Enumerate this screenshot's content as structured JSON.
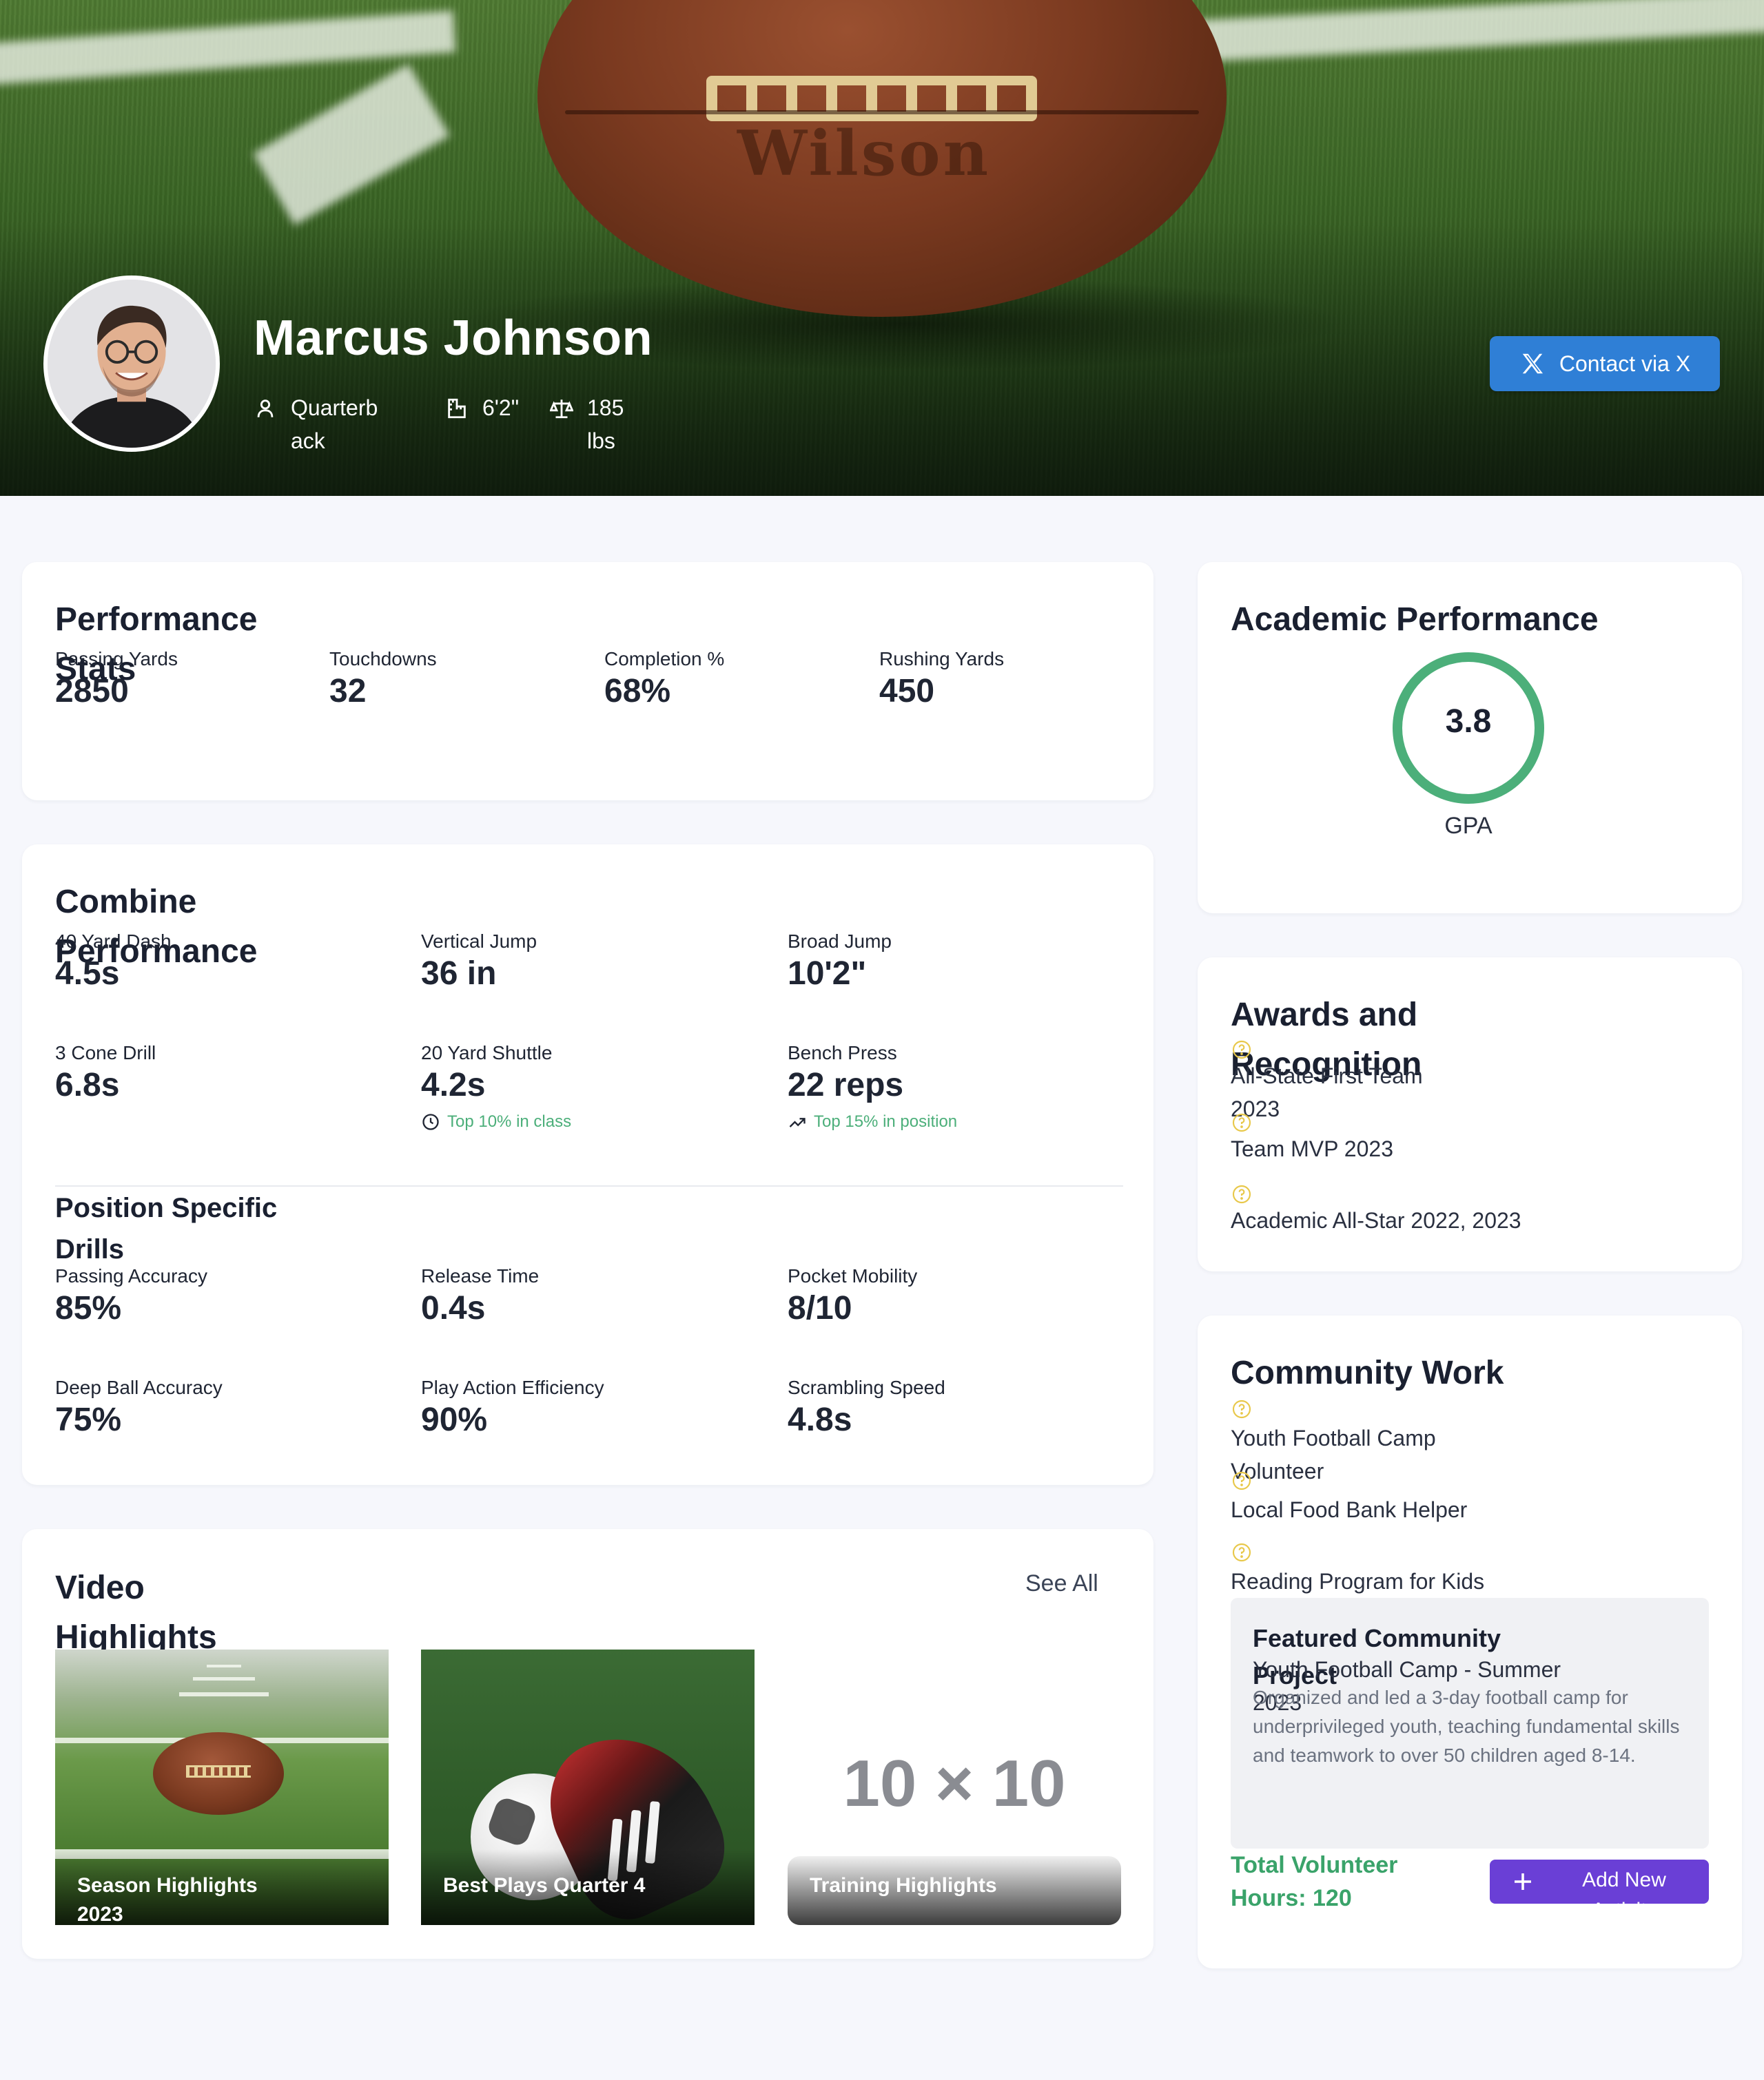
{
  "profile": {
    "name": "Marcus Johnson",
    "position": "Quarterback",
    "height": "6'2\"",
    "weight": "185 lbs",
    "contact_label": "Contact via X"
  },
  "performance": {
    "title": "Performance Stats",
    "stats": [
      {
        "label": "Passing Yards",
        "value": "2850"
      },
      {
        "label": "Touchdowns",
        "value": "32"
      },
      {
        "label": "Completion %",
        "value": "68%"
      },
      {
        "label": "Rushing Yards",
        "value": "450"
      }
    ]
  },
  "combine": {
    "title": "Combine Performance",
    "stats": [
      {
        "label": "40 Yard Dash",
        "value": "4.5s"
      },
      {
        "label": "Vertical Jump",
        "value": "36 in"
      },
      {
        "label": "Broad Jump",
        "value": "10'2\""
      },
      {
        "label": "3 Cone Drill",
        "value": "6.8s"
      },
      {
        "label": "20 Yard Shuttle",
        "value": "4.2s",
        "note": "Top 10% in class",
        "note_icon": "clock-icon"
      },
      {
        "label": "Bench Press",
        "value": "22 reps",
        "note": "Top 15% in position",
        "note_icon": "trending-up-icon"
      }
    ],
    "drills_title": "Position Specific Drills",
    "drills": [
      {
        "label": "Passing Accuracy",
        "value": "85%"
      },
      {
        "label": "Release Time",
        "value": "0.4s"
      },
      {
        "label": "Pocket Mobility",
        "value": "8/10"
      },
      {
        "label": "Deep Ball Accuracy",
        "value": "75%"
      },
      {
        "label": "Play Action Efficiency",
        "value": "90%"
      },
      {
        "label": "Scrambling Speed",
        "value": "4.8s"
      }
    ]
  },
  "academic": {
    "title": "Academic Performance",
    "gpa": "3.8",
    "gpa_label": "GPA",
    "ring_color": "#4caf7a"
  },
  "awards": {
    "title": "Awards and Recognition",
    "items": [
      "All-State First Team 2023",
      "Team MVP 2023",
      "Academic All-Star 2022, 2023"
    ],
    "icon": "award-icon",
    "icon_color": "#e8c84a"
  },
  "community": {
    "title": "Community Work",
    "items": [
      "Youth Football Camp Volunteer",
      "Local Food Bank Helper",
      "Reading Program for Kids"
    ],
    "featured": {
      "title": "Featured Community Project",
      "name": "Youth Football Camp - Summer 2023",
      "description": "Organized and led a 3-day football camp for underprivileged youth, teaching fundamental skills and teamwork to over 50 children aged 8-14."
    },
    "volunteer_hours": "Total Volunteer Hours: 120",
    "add_label": "Add New Activity"
  },
  "videos": {
    "title": "Video Highlights",
    "see_all": "See All",
    "items": [
      {
        "title": "Season Highlights 2023"
      },
      {
        "title": "Best Plays Quarter 4"
      },
      {
        "title": "Training Highlights",
        "placeholder": "10 × 10"
      }
    ]
  },
  "colors": {
    "accent_blue": "#2f7fd6",
    "accent_purple": "#6a3fd6",
    "success_green": "#3aa36a",
    "background": "#f6f7fc"
  }
}
